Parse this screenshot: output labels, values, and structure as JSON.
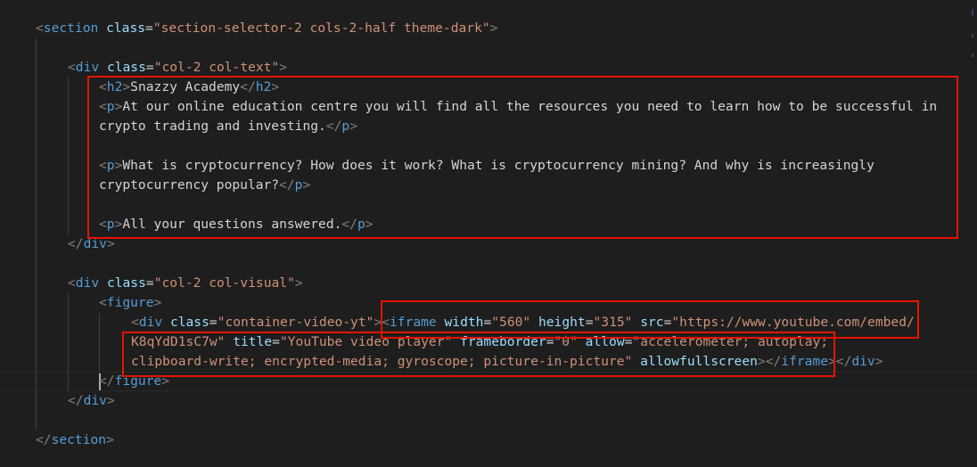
{
  "code": {
    "section_open": {
      "tag": "section",
      "attr": "class",
      "value": "\"section-selector-2 cols-2-half theme-dark\""
    },
    "div_text_open": {
      "tag": "div",
      "attr": "class",
      "value": "\"col-2 col-text\""
    },
    "h2": {
      "tag": "h2",
      "text": "Snazzy Academy"
    },
    "p1_text_a": "At our online education centre you will find all the resources you need to learn how to be successful in",
    "p1_text_b": "crypto trading and investing.",
    "p2_text_a": "What is cryptocurrency? How does it work? What is cryptocurrency mining? And why is increasingly",
    "p2_text_b": "cryptocurrency popular?",
    "p3_text": "All your questions answered.",
    "div_visual_open": {
      "tag": "div",
      "attr": "class",
      "value": "\"col-2 col-visual\""
    },
    "figure": "figure",
    "div_video_open": {
      "tag": "div",
      "attr": "class",
      "value": "\"container-video-yt\""
    },
    "iframe": {
      "tag": "iframe",
      "width_attr": "width",
      "width_val": "\"560\"",
      "height_attr": "height",
      "height_val": "\"315\"",
      "src_attr": "src",
      "src_val_a": "\"https://www.youtube.com/embed/",
      "src_val_b": "K8qYdD1sC7w\"",
      "title_attr": "title",
      "title_val": "\"YouTube video player\"",
      "frameborder_attr": "frameborder",
      "frameborder_val": "\"0\"",
      "allow_attr": "allow",
      "allow_val_a": "\"accelerometer; autoplay;",
      "allow_val_b": "clipboard-write; encrypted-media; gyroscope; picture-in-picture\"",
      "fullscreen_attr": "allowfullscreen"
    },
    "tag_div": "div",
    "tag_p": "p",
    "tag_section": "section",
    "tag_figure": "figure"
  },
  "colors": {
    "background": "#1e1e1e",
    "tag": "#569cd6",
    "attribute": "#9cdcfe",
    "string": "#ce9178",
    "text": "#d4d4d4",
    "bracket": "#808080",
    "highlight_box": "#e51400"
  }
}
